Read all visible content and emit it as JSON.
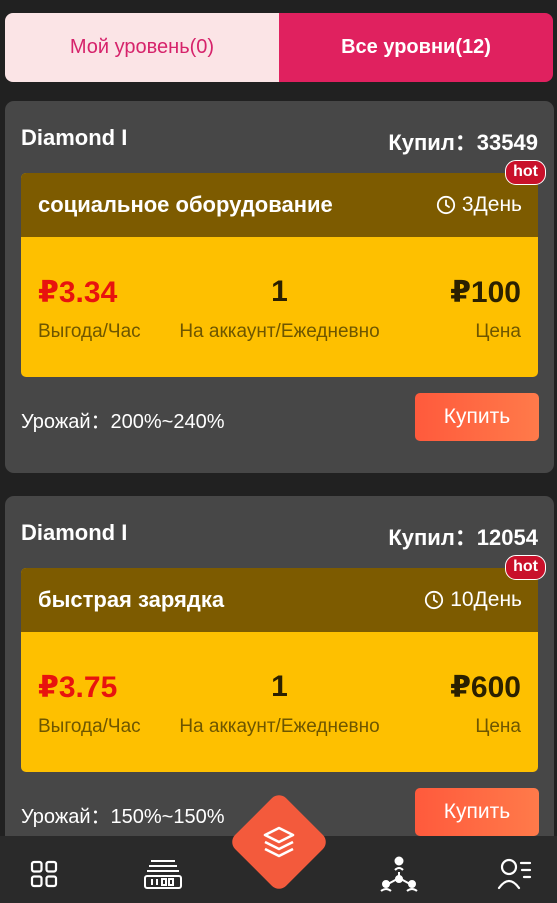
{
  "tabs": {
    "my_levels": "Мой уровень(0)",
    "all_levels": "Все уровни(12)"
  },
  "cards": [
    {
      "level": "Diamond I",
      "bought": "Купил：33549",
      "hot": "hot",
      "product_name": "социальное оборудование",
      "duration": "3День",
      "gain_value": "₽3.34",
      "gain_label": "Выгода/Час",
      "per_value": "1",
      "per_label": "На аккаунт/Ежедневно",
      "price_value": "₽100",
      "price_label": "Цена",
      "yield": "Урожай：200%~240%",
      "buy": "Купить"
    },
    {
      "level": "Diamond I",
      "bought": "Купил：12054",
      "hot": "hot",
      "product_name": "быстрая зарядка",
      "duration": "10День",
      "gain_value": "₽3.75",
      "gain_label": "Выгода/Час",
      "per_value": "1",
      "per_label": "На аккаунт/Ежедневно",
      "price_value": "₽600",
      "price_label": "Цена",
      "yield": "Урожай：150%~150%",
      "buy": "Купить"
    }
  ],
  "colors": {
    "accent": "#e0215f",
    "card_bg": "#474747",
    "product_header": "#7d5b00",
    "product_body": "#fec000",
    "gain_red": "#e8130e",
    "buy_button": "#ff6a45"
  },
  "bottom_nav": {
    "items": [
      "grid-icon",
      "machine-icon",
      "layers-icon",
      "team-icon",
      "profile-list-icon"
    ]
  }
}
